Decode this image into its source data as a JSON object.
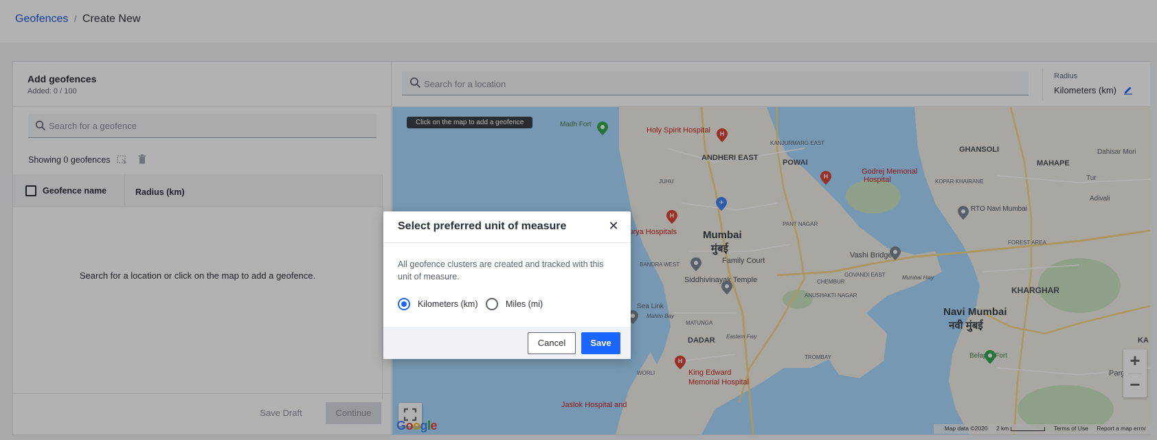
{
  "breadcrumb": {
    "parent": "Geofences",
    "separator": "/",
    "current": "Create New"
  },
  "left_panel": {
    "title": "Add geofences",
    "added": "Added: 0 / 100",
    "search_placeholder": "Search for a geofence",
    "showing": "Showing 0 geofences",
    "columns": {
      "name": "Geofence name",
      "radius": "Radius (km)"
    },
    "empty_message": "Search for a location or click on the map to add a geofence.",
    "save_draft": "Save Draft",
    "continue": "Continue"
  },
  "right_panel": {
    "search_placeholder": "Search for a location",
    "radius_label": "Radius",
    "radius_value": "Kilometers (km)",
    "map_hint": "Click on the map to add a geofence",
    "attribution": {
      "map_data": "Map data ©2020",
      "scale": "2 km",
      "terms": "Terms of Use",
      "report": "Report a map error"
    },
    "google": "Google",
    "map_labels": {
      "madh_fort": "Madh Fort",
      "holy_spirit": "Holy Spirit Hospital",
      "andheri_east": "ANDHERI EAST",
      "powai": "POWAI",
      "godrej": "Godrej Memorial",
      "hospital": "Hospital",
      "ghansoli": "GHANSOLI",
      "mahape": "MAHAPE",
      "dahisar_mori": "Dahisar Mori",
      "surya": "Surya Hospitals",
      "mumbai": "Mumbai",
      "mumbai_dev": "मुंबई",
      "rto": "RTO Navi Mumbai",
      "vashi_bridge": "Vashi Bridge",
      "family_court": "Family Court",
      "siddhivinayak": "Siddhivinayak Temple",
      "sea_link": "Sea Link",
      "kharghar": "KHARGHAR",
      "navi_mumbai": "Navi Mumbai",
      "navi_mumbai_dev": "नवी मुंबई",
      "dadar": "DADAR",
      "belapur": "Belapur Fort",
      "king_edward": "King Edward",
      "memorial_hospital": "Memorial Hospital",
      "jaslok": "Jaslok Hospital and",
      "pargaon": "Pargaon D",
      "kanjurmarg": "KANJURMARG EAST",
      "kopar": "KOPAR KHAIRANE",
      "bandra_west": "BANDRA WEST",
      "chembur": "CHEMBUR",
      "govandi": "GOVANDI EAST",
      "anushakti": "ANUSHAKTI NAGAR",
      "matunga": "MATUNGA",
      "trombay": "TROMBAY",
      "worli": "WORLI",
      "juhu": "JUHU",
      "pant_nagar": "PANT NAGAR",
      "forest_area": "FOREST AREA",
      "adivali": "Adivali",
      "mumbai_hwy": "Mumbai Hwy",
      "eastern_fwy": "Eastern Fwy",
      "mahim_bay": "Mahim Bay",
      "ka": "KA",
      "tur": "Tur"
    }
  },
  "modal": {
    "title": "Select preferred unit of measure",
    "description": "All geofence clusters are created and tracked with this unit of measure.",
    "options": [
      {
        "label": "Kilometers (km)",
        "selected": true
      },
      {
        "label": "Miles (mi)",
        "selected": false
      }
    ],
    "cancel": "Cancel",
    "save": "Save"
  },
  "colors": {
    "accent": "#1a66ff",
    "link": "#1a56db",
    "water": "#aadaff",
    "land": "#f2efe9",
    "poi_red": "#db4437"
  }
}
